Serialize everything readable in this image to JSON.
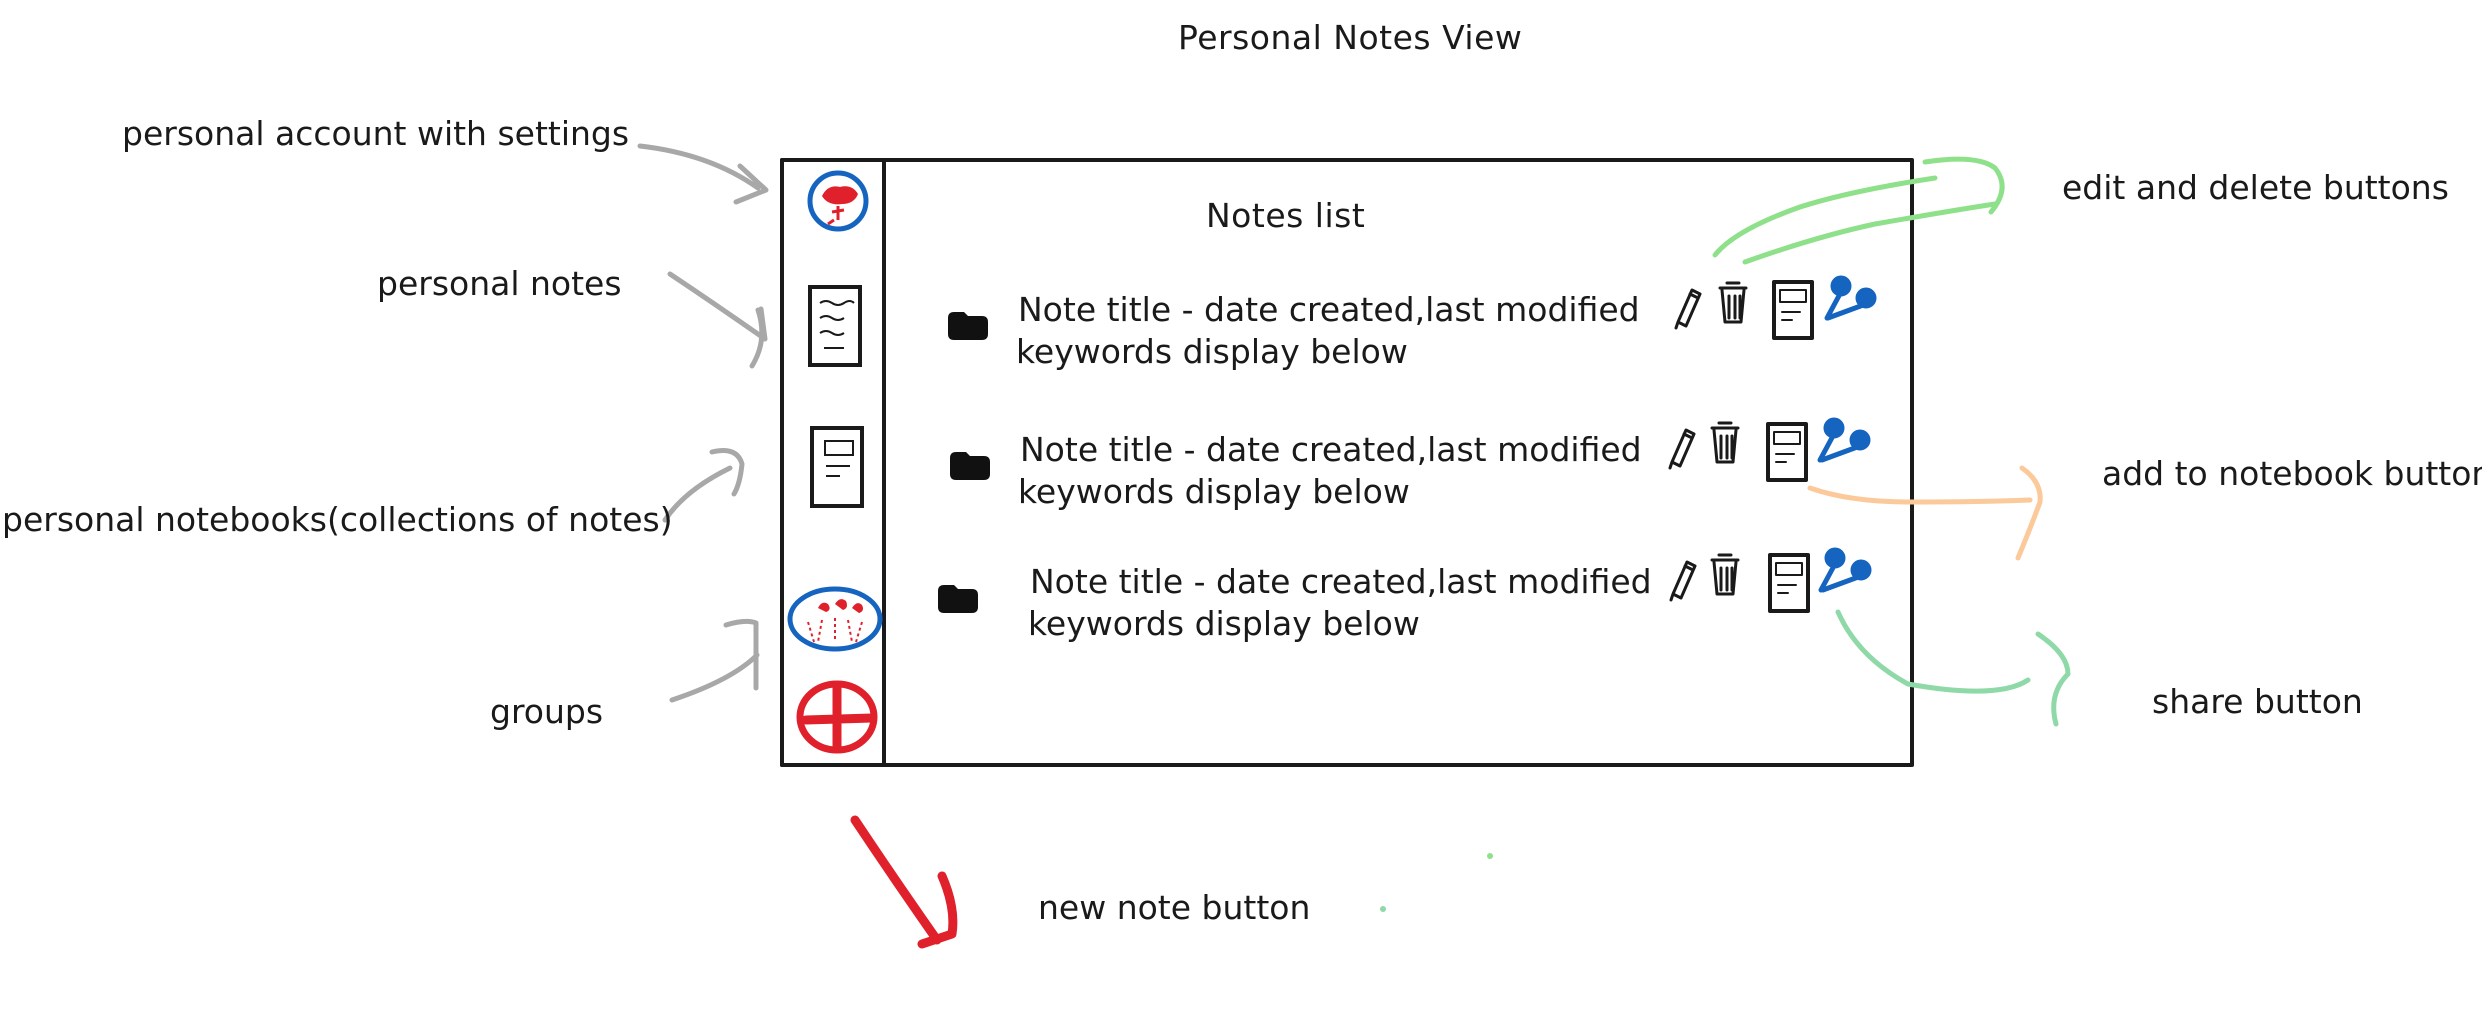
{
  "page_title": "Personal Notes View",
  "list_heading": "Notes list",
  "annotations": {
    "account": "personal account with settings",
    "notes": "personal notes",
    "notebooks": "personal notebooks(collections of notes)",
    "groups": "groups",
    "edit_delete": "edit and delete buttons",
    "add_to_notebook": "add to notebook button",
    "share": "share button",
    "new_note": "new note button"
  },
  "notes": [
    {
      "title_line": "Note title - date created,last modified",
      "keywords_line": "keywords display below"
    },
    {
      "title_line": "Note title - date created,last modified",
      "keywords_line": "keywords display below"
    },
    {
      "title_line": "Note title - date created,last modified",
      "keywords_line": "keywords display below"
    }
  ],
  "icons": {
    "account": "person-circle-icon",
    "notes": "note-page-icon",
    "notebooks": "notebook-icon",
    "groups": "group-circle-icon",
    "new_note": "plus-circle-icon",
    "note_bullet": "folder-icon",
    "edit": "pencil-icon",
    "delete": "trash-icon",
    "add_to_notebook": "notebook-icon",
    "share": "share-icon"
  },
  "colors": {
    "ink": "#1a1a1a",
    "arrow_gray": "#a8a8a8",
    "red": "#e0202a",
    "blue": "#1565c0",
    "green": "#8fe08a",
    "orange": "#fcc99a",
    "teal_green": "#8fd9a8"
  }
}
